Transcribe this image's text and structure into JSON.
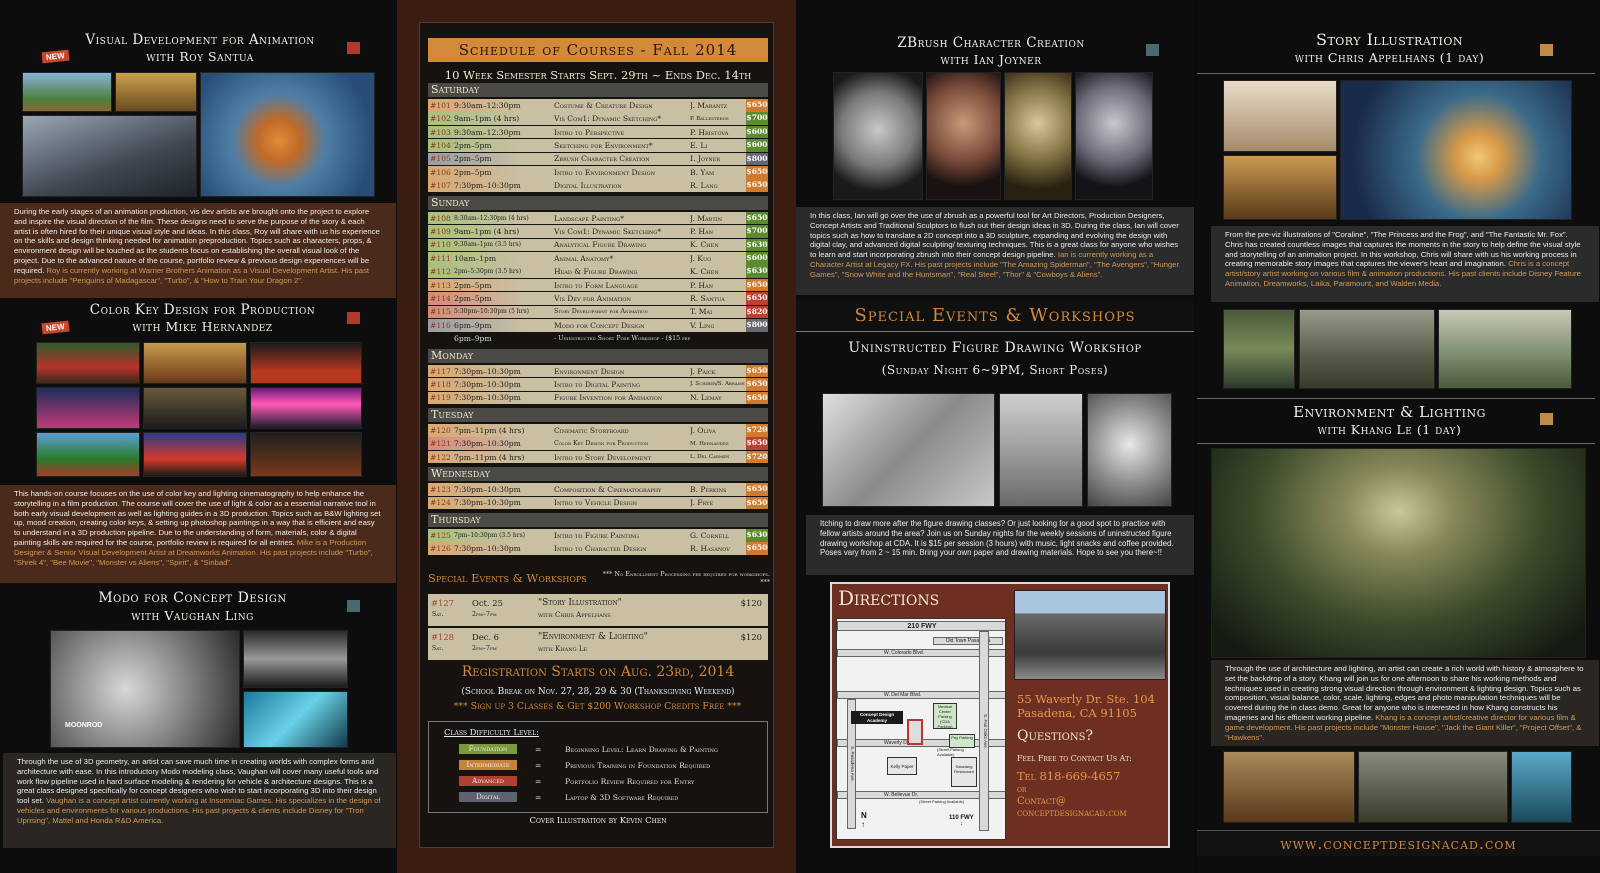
{
  "colors": {
    "foundation": "#7a9a3c",
    "intermediate": "#c6823a",
    "advanced": "#b04033",
    "digital": "#5f6370",
    "priceOrange": "#cf7a2e",
    "priceGreen": "#5c8a2e",
    "priceRed": "#b94132",
    "priceGray": "#66686f",
    "accentGold": "#cf8e3c"
  },
  "left": {
    "c1": {
      "title": "Visual Development for Animation",
      "sub": "with Roy Santua",
      "badge": "NEW",
      "desc": "During the early stages of an animation production, vis dev artists are brought onto the project to explore and inspire the visual direction of the film. These designs need to serve the purpose of the story & each artist is often hired for their unique visual style and ideas. In this class, Roy will share with us his experience on the skills and design thinking needed for animation preproduction. Topics such as characters, props, & environment design will be touched as the students focus on establishing the overall visual look of the project. Due to the advanced nature of the course, portfolio review & previous design experiences will be required.",
      "bio": "Roy is currently working at Warner Brothers Animation as a Visual Development Artist. His past projects include \"Penguins of Madagascar\", \"Turbo\", & \"How to Train Your Dragon 2\"."
    },
    "c2": {
      "title": "Color Key Design for Production",
      "sub": "with Mike Hernandez",
      "badge": "NEW",
      "desc": "This hands-on course focuses on the use of color key and lighting cinematography to help enhance the storytelling in a film production. The course will cover the use of light & color as a essential narrative tool in both early visual development as well as lighting guides in a 3D production. Topics such as B&W lighting set up, mood creation, creating color keys, & setting up photoshop paintings in a way that is efficient and easy to understand in a 3D production pipeline. Due to the understanding of form, materials, color & digital painting skills are required for the course, portfolio review is required for all entries.",
      "bio": "Mike is a Production Designer & Senior Visual Development Artist at Dreamworks Animation. His past projects include \"Turbo\", \"Shrek 4\", \"Bee Movie\", \"Monster vs Aliens\", \"Spirit\", & \"Sinbad\"."
    },
    "c3": {
      "title": "Modo for Concept Design",
      "sub": "with Vaughan Ling",
      "imgtext": "MOONROD",
      "desc": "Through the use of 3D geometry, an artist can save much time in creating worlds with complex forms and architecture with ease. In this introductory Modo modeling class, Vaughan will cover many useful tools and work flow pipeline used in hard surface modeling & rendering for vehicle & architecture designs. This is a great class designed specifically for concept designers who wish to start incorporating 3D into their design tool set.",
      "bio": "Vaughan is a concept artist currently working at Insomniac Games. His specializes in the design of vehicles and environments for various productions. His past projects & clients include Disney for \"Tron Uprising\", Mattel and Honda R&D America."
    }
  },
  "schedule": {
    "title": "Schedule of Courses - Fall 2014",
    "semester": "10 Week Semester Starts Sept. 29th ~ Ends Dec. 14th",
    "saturday": "Saturday",
    "fieldtrip": "* = Field trip required classes",
    "sat": [
      {
        "n": "#101",
        "t": "9:30am–12:30pm",
        "c": "Costume & Creature Design",
        "i": "J. Marantz",
        "p": "$650",
        "k": "orange",
        "lv": "orange"
      },
      {
        "n": "#102",
        "t": "9am–1pm (4 hrs)",
        "c": "Vis Com1: Dynamic Sketching*",
        "i": "P. Ballesteros",
        "p": "$700",
        "k": "green",
        "lv": "green"
      },
      {
        "n": "#103",
        "t": "9:30am–12:30pm",
        "c": "Intro to Perspective",
        "i": "P. Hristova",
        "p": "$600",
        "k": "green",
        "lv": "green"
      },
      {
        "n": "#104",
        "t": "2pm–5pm",
        "c": "Sketching for Environment*",
        "i": "E. Li",
        "p": "$600",
        "k": "green",
        "lv": "green"
      },
      {
        "n": "#105",
        "t": "2pm–5pm",
        "c": "Zbrush Character Creation",
        "i": "I. Joyner",
        "p": "$800",
        "k": "gray",
        "lv": "gray"
      },
      {
        "n": "#106",
        "t": "2pm–5pm",
        "c": "Intro to Environment Design",
        "i": "B. Yam",
        "p": "$650",
        "k": "orange",
        "lv": "orange"
      },
      {
        "n": "#107",
        "t": "7:30pm–10:30pm",
        "c": "Digital Illustration",
        "i": "R. Lang",
        "p": "$650",
        "k": "orange",
        "lv": "orange"
      }
    ],
    "sunday": "Sunday",
    "sun": [
      {
        "n": "#108",
        "t": "8:30am–12:30pm (4 hrs)",
        "c": "Landscape Painting*",
        "i": "J. Martin",
        "p": "$650",
        "k": "green",
        "lv": "green"
      },
      {
        "n": "#109",
        "t": "9am–1pm (4 hrs)",
        "c": "Vis Com1: Dynamic Sketching*",
        "i": "P. Han",
        "p": "$700",
        "k": "green",
        "lv": "green"
      },
      {
        "n": "#110",
        "t": "9:30am–1pm (3.5 hrs)",
        "c": "Analytical Figure Drawing",
        "i": "K. Chen",
        "p": "$630",
        "k": "green",
        "lv": "green"
      },
      {
        "n": "#111",
        "t": "10am–1pm",
        "c": "Animal Anatomy*",
        "i": "J. Kuo",
        "p": "$600",
        "k": "green",
        "lv": "green"
      },
      {
        "n": "#112",
        "t": "2pm–5:30pm (3.5 hrs)",
        "c": "Head & Figure Drawing",
        "i": "K. Chen",
        "p": "$630",
        "k": "green",
        "lv": "green"
      },
      {
        "n": "#113",
        "t": "2pm–5pm",
        "c": "Intro to Form Language",
        "i": "P. Han",
        "p": "$650",
        "k": "orange",
        "lv": "orange"
      },
      {
        "n": "#114",
        "t": "2pm–5pm",
        "c": "Vis Dev for Animation",
        "i": "R. Santua",
        "p": "$650",
        "k": "red",
        "lv": "red"
      },
      {
        "n": "#115",
        "t": "5:30pm–10:30pm (5 hrs)",
        "c": "Story Development for Animation",
        "i": "T. Mai",
        "p": "$820",
        "k": "red",
        "lv": "red"
      },
      {
        "n": "#116",
        "t": "6pm–9pm",
        "c": "Modo for Concept Design",
        "i": "V. Ling",
        "p": "$800",
        "k": "gray",
        "lv": "gray"
      },
      {
        "n": "",
        "t": "6pm–9pm",
        "c": "- Uninstructed Short Pose Workshop - ($15 per session)",
        "i": "",
        "p": "",
        "k": "none",
        "lv": "none"
      }
    ],
    "monday": "Monday",
    "mon": [
      {
        "n": "#117",
        "t": "7:30pm–10:30pm",
        "c": "Environment Design",
        "i": "J. Paick",
        "p": "$650",
        "k": "orange",
        "lv": "orange"
      },
      {
        "n": "#118",
        "t": "7:30pm–10:30pm",
        "c": "Intro to Digital Painting",
        "i": "J. Schiber/S. Abrams",
        "p": "$650",
        "k": "orange",
        "lv": "orange"
      },
      {
        "n": "#119",
        "t": "7:30pm–10:30pm",
        "c": "Figure Invention for Animation",
        "i": "N. Lemay",
        "p": "$650",
        "k": "orange",
        "lv": "orange"
      }
    ],
    "tuesday": "Tuesday",
    "tue": [
      {
        "n": "#120",
        "t": "7pm–11pm (4 hrs)",
        "c": "Cinematic Storyboard",
        "i": "J. Oliva",
        "p": "$720",
        "k": "orange",
        "lv": "orange"
      },
      {
        "n": "#121",
        "t": "7:30pm–10:30pm",
        "c": "Color Key Design for Production",
        "i": "M. Hernandez",
        "p": "$650",
        "k": "red",
        "lv": "red"
      },
      {
        "n": "#122",
        "t": "7pm–11pm (4 hrs)",
        "c": "Intro to Story Development",
        "i": "L. Del Carmen",
        "p": "$720",
        "k": "orange",
        "lv": "orange"
      }
    ],
    "wednesday": "Wednesday",
    "wed": [
      {
        "n": "#123",
        "t": "7:30pm–10:30pm",
        "c": "Composition & Cinematography",
        "i": "B. Perkins",
        "p": "$650",
        "k": "orange",
        "lv": "orange"
      },
      {
        "n": "#124",
        "t": "7:30pm–10:30pm",
        "c": "Intro to Vehicle Design",
        "i": "J. Frye",
        "p": "$650",
        "k": "orange",
        "lv": "orange"
      }
    ],
    "thursday": "Thursday",
    "thu": [
      {
        "n": "#125",
        "t": "7pm–10:30pm (3.5 hrs)",
        "c": "Intro to Figure Painting",
        "i": "G. Cornell",
        "p": "$630",
        "k": "green",
        "lv": "green"
      },
      {
        "n": "#126",
        "t": "7:30pm–10:30pm",
        "c": "Intro to Character Design",
        "i": "R. Hasanov",
        "p": "$650",
        "k": "orange",
        "lv": "orange"
      }
    ],
    "specialTitle": "Special Events & Workshops",
    "specialNote": "*** No Enrollment Processing fee required for workshops. ***",
    "ev1": {
      "n": "#127",
      "d": "Oct. 25",
      "dw": "Sat.",
      "tm": "2pm–7pm",
      "t": "\"Story Illustration\"",
      "w": "with Chris Appelhans",
      "p": "$120"
    },
    "ev2": {
      "n": "#128",
      "d": "Dec. 6",
      "dw": "Sat.",
      "tm": "2pm–7pm",
      "t": "\"Environment & Lighting\"",
      "w": "with Khang Le",
      "p": "$120"
    },
    "reg": "Registration Starts on Aug. 23rd, 2014",
    "break": "(School Break on Nov. 27, 28, 29 & 30 (Thanksgiving Weekend)",
    "promo": "*** Sign up 3 Classes & Get $200 Workshop Credits Free ***",
    "legendTitle": "Class Difficulty Level:",
    "legend": [
      {
        "l": "Foundation",
        "d": "Beginning Level: Learn Drawing & Painting"
      },
      {
        "l": "Intermediate",
        "d": "Previous Training in Foundation Required"
      },
      {
        "l": "Advanced",
        "d": "Portfolio Review Required for Entry"
      },
      {
        "l": "Digital",
        "d": "Laptop & 3D Software Required"
      }
    ],
    "eq": "=",
    "cover": "Cover Illustration by Kevin Chen"
  },
  "right1": {
    "z": {
      "title": "ZBrush Character Creation",
      "sub": "with Ian Joyner",
      "desc": "In this class, Ian will go over the use of zbrush as a powerful tool for Art Directors, Production Designers, Concept Artists and Traditional Sculptors to flush out their design ideas in 3D. During the class, Ian will cover topics such as how to translate a 2D concept into a 3D sculpture, expanding and evolving the design with digital clay, and advanced digital sculpting/ texturing techniques. This is a great class for anyone who wishes to learn and start incorporating zbrush into their concept design pipeline.",
      "bio": "Ian is currently working as a Character Artist at Legacy FX. His past projects include \"The Amazing Spiderman\", \"The Avengers\", \"Hunger Games\", \"Snow White and the Huntsman\", \"Real Steel\", \"Thor\" & \"Cowboys & Aliens\"."
    },
    "specialTitle": "Special Events & Workshops",
    "wsTitle": "Uninstructed Figure Drawing Workshop",
    "wsSub": "(Sunday Night 6~9PM, Short Poses)",
    "wsDesc": "Itching to draw more after the figure drawing classes? Or just looking for a good spot to practice with fellow artists around the area? Join us on Sunday nights for the weekly sessions of uninstructed figure drawing workshop at CDA. It is $15 per session (3 hours) with music, light snacks and coffee provided. Poses vary from 2 ~ 15 min. Bring your own paper and drawing materials. Hope to see you there~!!",
    "dir": {
      "title": "Directions",
      "fwy210": "210 FWY",
      "fwy110": "110 FWY",
      "n": "N",
      "oldtown": "Old Town Pasadena",
      "colorado": "W. Colorado Blvd.",
      "delmar": "W. Del Mar Blvd.",
      "waverly": "Waverly Dr.",
      "bellevue": "W. Bellevue Dr.",
      "fairoaks": "S. Fair Oaks Ave.",
      "pasadena": "S. Pasadena Ave.",
      "cda": "Concept Design Academy",
      "medical": "Medical Center Parking (CDA Parking)",
      "pay": "Pay Parking",
      "kelly": "Kelly Paper",
      "saladang": "Saladang Restaurant",
      "streetpark1": "(Street Parking Available)",
      "streetpark2": "(Street Parking Available)",
      "addr1": "55 Waverly Dr. Ste. 104",
      "addr2": "Pasadena, CA 91105",
      "q": "Questions?",
      "contact": "Feel Free to Contact Us At:",
      "tel": "Tel 818-669-4657",
      "or": "or",
      "email1": "Contact@",
      "email2": "conceptdesignacad.com"
    }
  },
  "right2": {
    "s": {
      "title": "Story Illustration",
      "sub": "with Chris Appelhans (1 day)",
      "desc": "From the pre-viz illustrations of \"Coraline\", \"The Princess and the Frog\", and \"The Fantastic Mr. Fox\". Chris has created countless images that captures the moments in the story to help define the visual style and storytelling of an animation project. In this workshop, Chris will share with us his working process in creating memorable story images that captures the viewer's heart and imagination.",
      "bio": "Chris is a concept artist/story artist working on various film & animation productions. His past clients include Disney Feature Animation, Dreamworks, Laika, Paramount, and Walden Media."
    },
    "e": {
      "title": "Environment & Lighting",
      "sub": "with Khang Le (1 day)",
      "desc": "Through the use of architecture and lighting, an artist can create a rich world with history & atmosphere to set the backdrop of a story. Khang will join us for one afternoon to share his working methods and techniques used in creating strong visual direction through environment & lighting design. Topics such as composition, visual balance, color, scale, lighting, edges and photo manipulation techniques will be covered during the in class demo. Great for anyone who is interested in how Khang constructs his imageries and his efficient working pipeline.",
      "bio": "Khang is a concept artist/creative director for various film & game development. His past projects include \"Monster House\", \"Jack the Giant Killer\", \"Project Offset\", & \"Hawkens\"."
    },
    "url": "www.conceptdesignacad.com"
  }
}
